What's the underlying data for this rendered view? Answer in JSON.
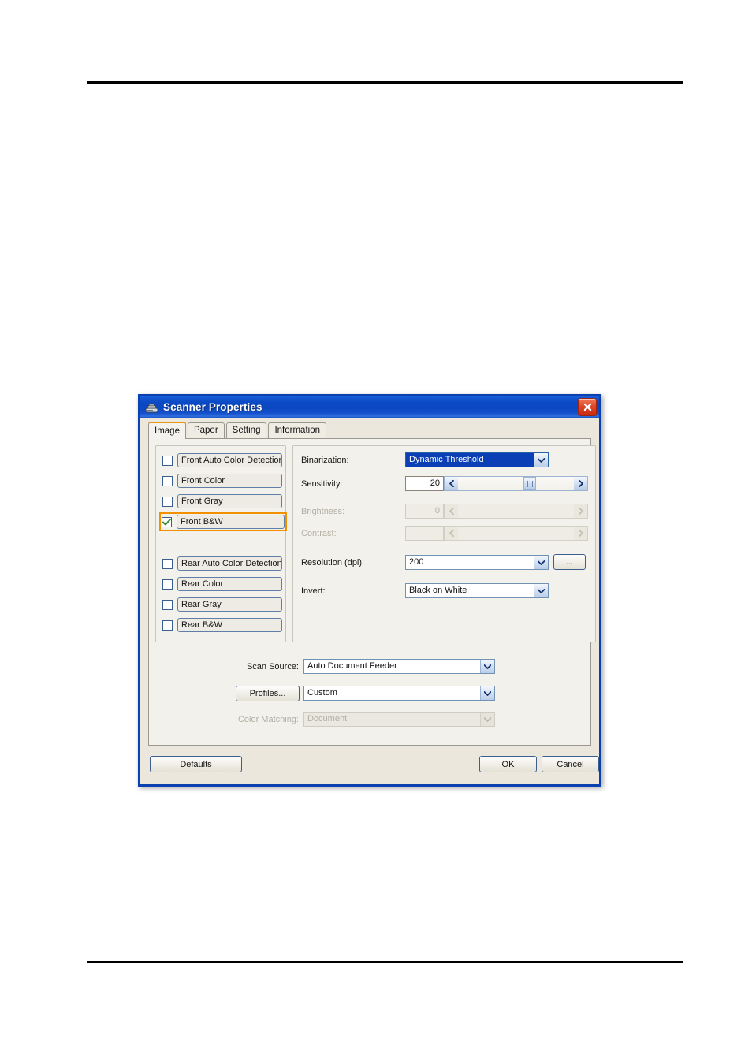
{
  "dialog": {
    "title": "Scanner Properties",
    "title_icon": "scanner-icon",
    "close_label": "×"
  },
  "tabs": [
    {
      "label": "Image",
      "active": true
    },
    {
      "label": "Paper",
      "active": false
    },
    {
      "label": "Setting",
      "active": false
    },
    {
      "label": "Information",
      "active": false
    }
  ],
  "channels": {
    "front": [
      {
        "label": "Front Auto Color Detection",
        "checked": false,
        "highlighted": false
      },
      {
        "label": "Front Color",
        "checked": false,
        "highlighted": false
      },
      {
        "label": "Front Gray",
        "checked": false,
        "highlighted": false
      },
      {
        "label": "Front B&W",
        "checked": true,
        "highlighted": true
      }
    ],
    "rear": [
      {
        "label": "Rear Auto Color Detection",
        "checked": false,
        "highlighted": false
      },
      {
        "label": "Rear Color",
        "checked": false,
        "highlighted": false
      },
      {
        "label": "Rear Gray",
        "checked": false,
        "highlighted": false
      },
      {
        "label": "Rear B&W",
        "checked": false,
        "highlighted": false
      }
    ]
  },
  "settings": {
    "binarization": {
      "label": "Binarization:",
      "value": "Dynamic Threshold",
      "selected": true,
      "enabled": true
    },
    "sensitivity": {
      "label": "Sensitivity:",
      "value": "20",
      "enabled": true,
      "thumb_percent": 62
    },
    "brightness": {
      "label": "Brightness:",
      "value": "0",
      "enabled": false
    },
    "contrast": {
      "label": "Contrast:",
      "value": "",
      "enabled": false
    },
    "resolution": {
      "label": "Resolution (dpi):",
      "value": "200",
      "enabled": true,
      "more_button": "..."
    },
    "invert": {
      "label": "Invert:",
      "value": "Black on White",
      "enabled": true
    }
  },
  "bottom": {
    "scan_source": {
      "label": "Scan Source:",
      "value": "Auto Document Feeder",
      "enabled": true
    },
    "profiles_button": "Profiles...",
    "profiles": {
      "value": "Custom",
      "enabled": true
    },
    "color_matching": {
      "label": "Color Matching:",
      "value": "Document",
      "enabled": false
    }
  },
  "footer": {
    "defaults": "Defaults",
    "ok": "OK",
    "cancel": "Cancel"
  },
  "colors": {
    "titlebar_blue": "#0b47c0",
    "dialog_border": "#0a40b0",
    "highlight_orange": "#f29100",
    "selection_blue": "#0a3fb5",
    "dialog_face": "#ebe7dc",
    "panel_face": "#f2f1ec",
    "check_green": "#3a8a32"
  }
}
